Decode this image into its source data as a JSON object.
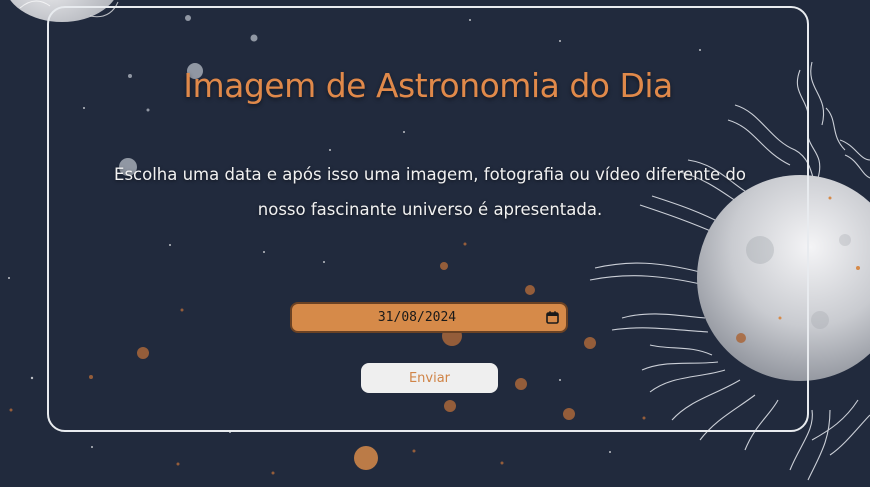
{
  "page": {
    "title": "Imagem de Astronomia do Dia",
    "description": "Escolha uma data e após isso uma imagem, fotografia ou vídeo diferente do nosso fascinante universo é apresentada."
  },
  "form": {
    "date_value": "31/08/2024",
    "date_icon": "calendar-icon",
    "submit_label": "Enviar"
  },
  "theme": {
    "background": "#212a3d",
    "accent": "#d68a49",
    "title_color": "#e0894a",
    "card_border": "#e8ebef"
  }
}
